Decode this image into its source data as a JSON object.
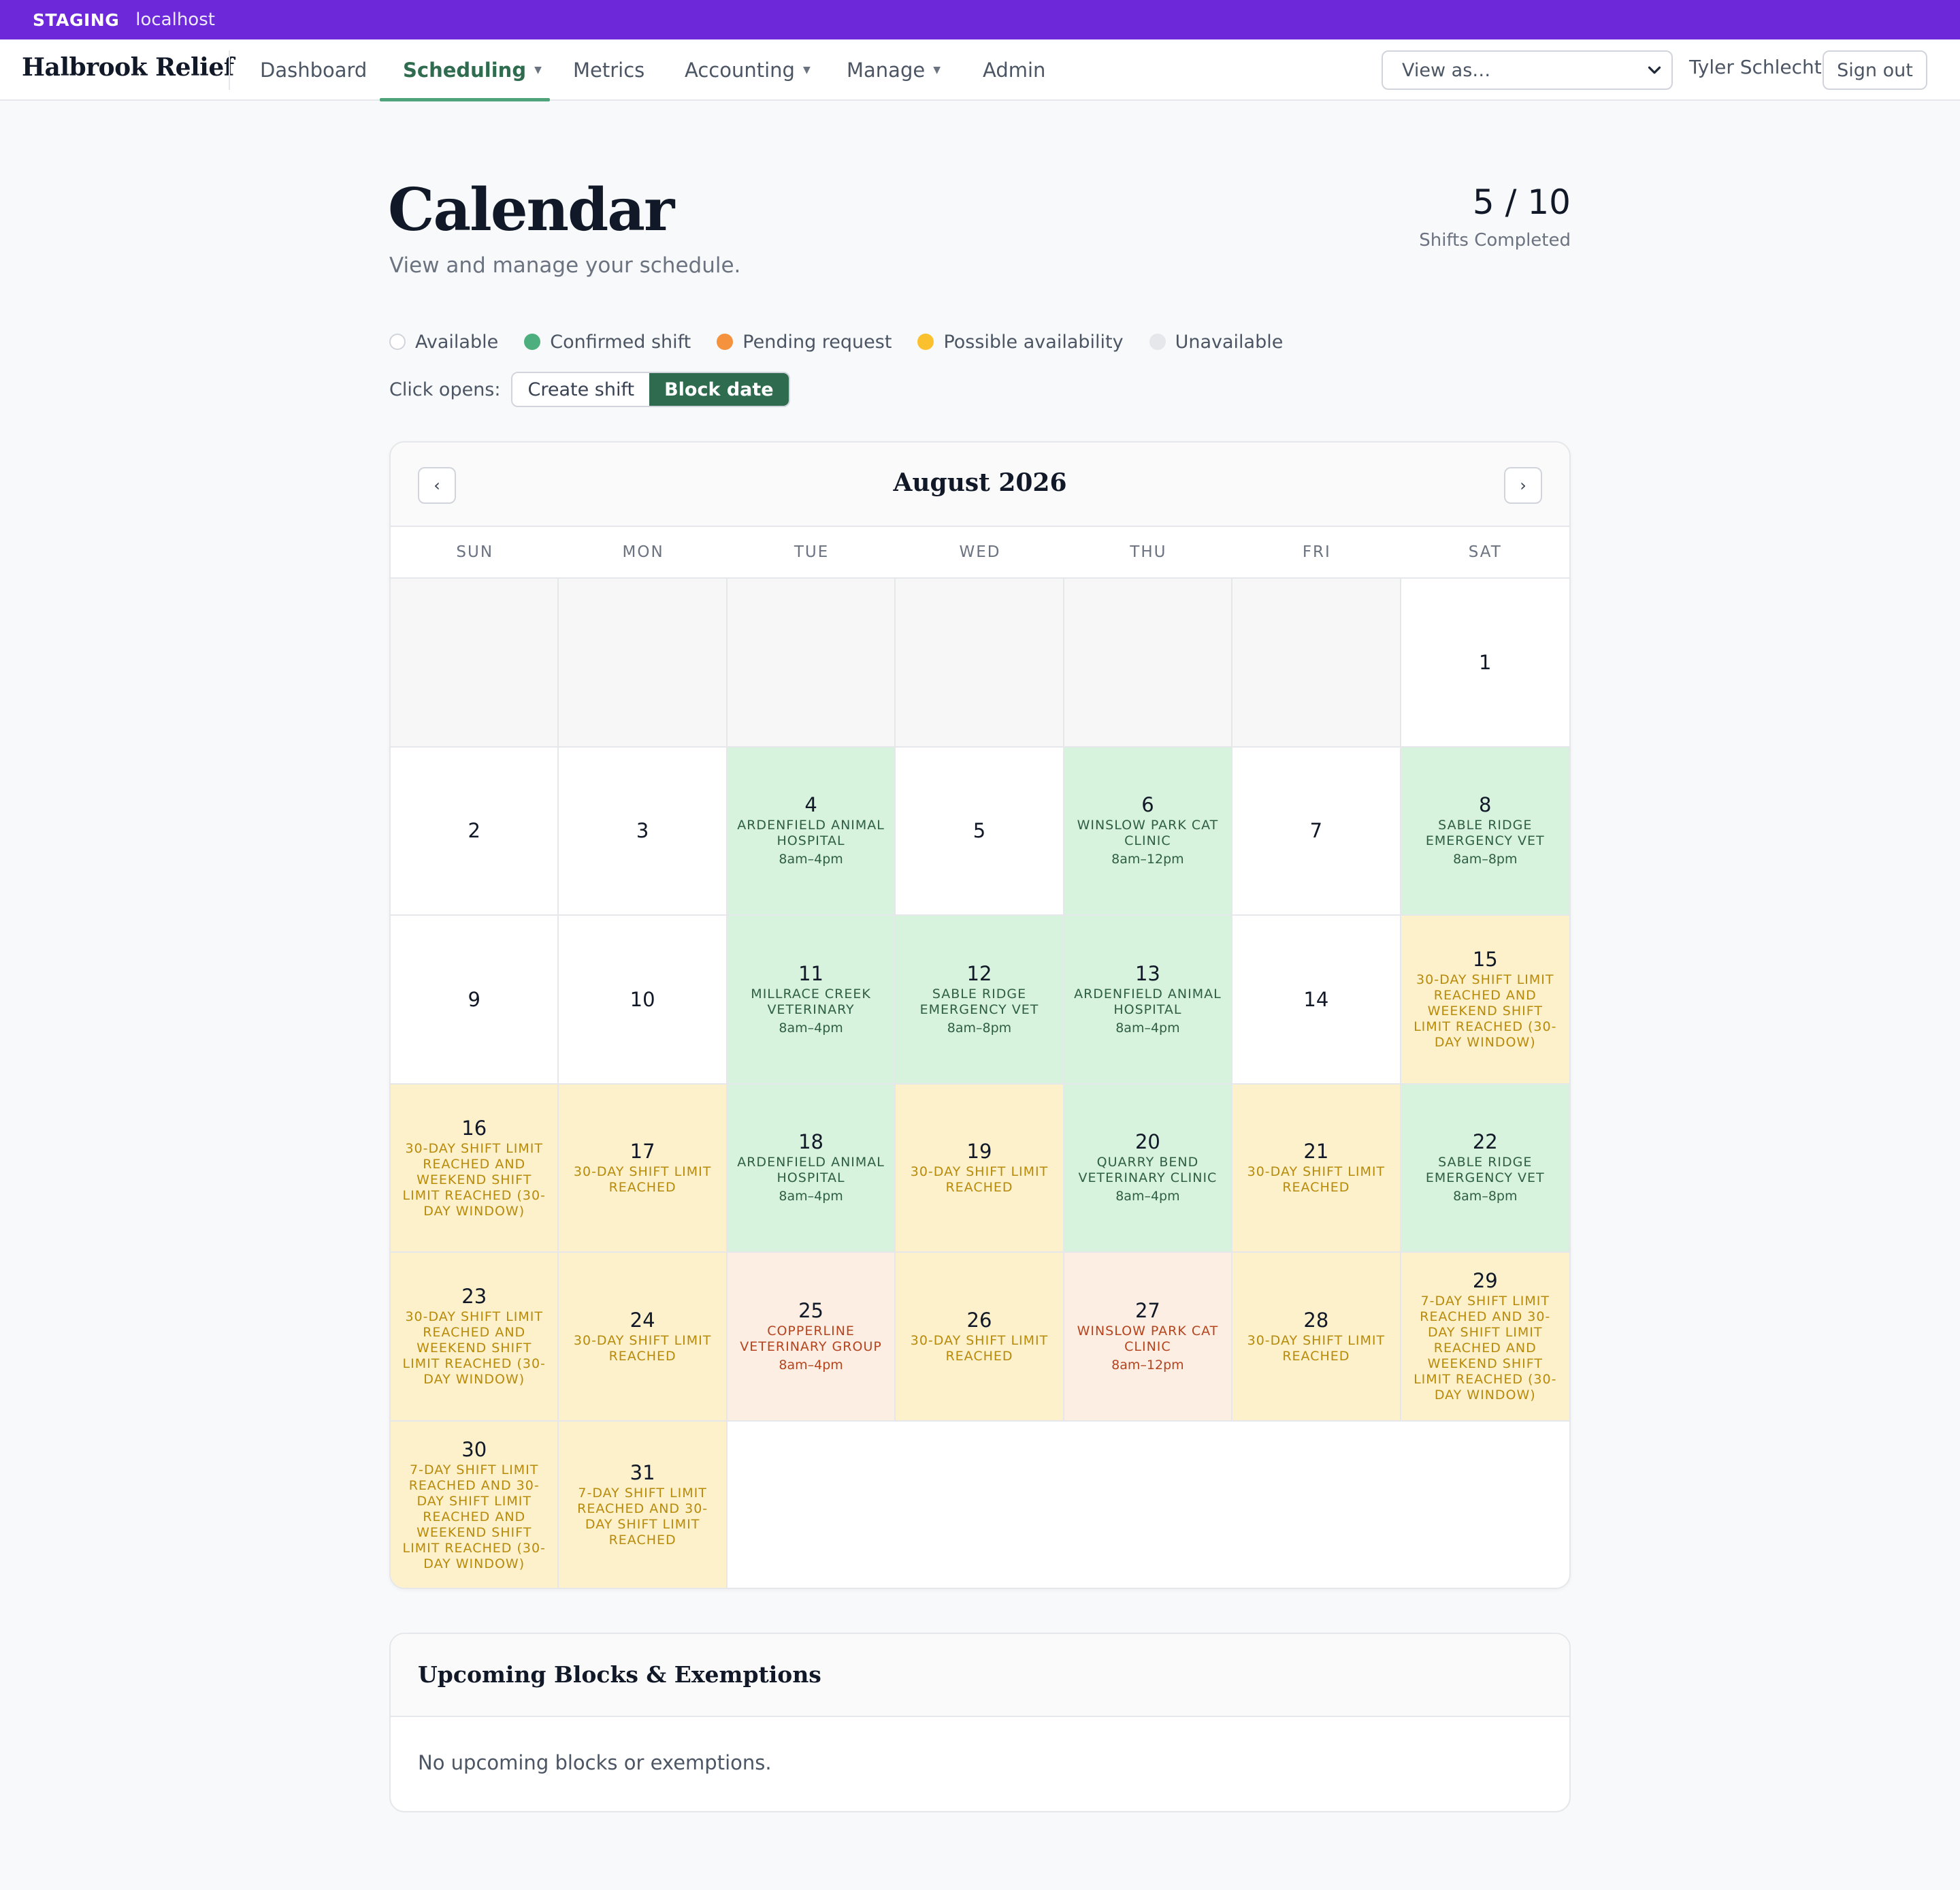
{
  "staging": {
    "tag": "STAGING",
    "host": "localhost"
  },
  "nav": {
    "brand": "Halbrook Relief",
    "items": [
      {
        "label": "Dashboard",
        "caret": false,
        "active": false
      },
      {
        "label": "Scheduling",
        "caret": true,
        "active": true
      },
      {
        "label": "Metrics",
        "caret": false,
        "active": false
      },
      {
        "label": "Accounting",
        "caret": true,
        "active": false
      },
      {
        "label": "Manage",
        "caret": true,
        "active": false
      },
      {
        "label": "Admin",
        "caret": false,
        "active": false
      }
    ],
    "view_as": "View as…",
    "user": "Tyler Schlecht",
    "sign_out": "Sign out"
  },
  "header": {
    "title": "Calendar",
    "subtitle": "View and manage your schedule.",
    "stat_value": "5 / 10",
    "stat_label": "Shifts Completed"
  },
  "legend": [
    {
      "label": "Available",
      "color": "#ffffff"
    },
    {
      "label": "Confirmed shift",
      "color": "#4caf7d"
    },
    {
      "label": "Pending request",
      "color": "#f5923e"
    },
    {
      "label": "Possible availability",
      "color": "#fbc02d"
    },
    {
      "label": "Unavailable",
      "color": "#e5e7eb"
    }
  ],
  "click_opens": {
    "label": "Click opens:",
    "options": [
      "Create shift",
      "Block date"
    ],
    "selected": "Block date"
  },
  "calendar": {
    "month": "August 2026",
    "prev": "‹",
    "next": "›",
    "weekdays": [
      "SUN",
      "MON",
      "TUE",
      "WED",
      "THU",
      "FRI",
      "SAT"
    ],
    "leading_blanks": 6,
    "days": [
      {
        "day": "1",
        "type": "available"
      },
      {
        "day": "2",
        "type": "available"
      },
      {
        "day": "3",
        "type": "available"
      },
      {
        "day": "4",
        "type": "confirmed",
        "clinic": "ARDENFIELD ANIMAL HOSPITAL",
        "time": "8am–4pm"
      },
      {
        "day": "5",
        "type": "available"
      },
      {
        "day": "6",
        "type": "confirmed",
        "clinic": "WINSLOW PARK CAT CLINIC",
        "time": "8am–12pm"
      },
      {
        "day": "7",
        "type": "available"
      },
      {
        "day": "8",
        "type": "confirmed",
        "clinic": "SABLE RIDGE EMERGENCY VET",
        "time": "8am–8pm"
      },
      {
        "day": "9",
        "type": "available"
      },
      {
        "day": "10",
        "type": "available"
      },
      {
        "day": "11",
        "type": "confirmed",
        "clinic": "MILLRACE CREEK VETERINARY",
        "time": "8am–4pm"
      },
      {
        "day": "12",
        "type": "confirmed",
        "clinic": "SABLE RIDGE EMERGENCY VET",
        "time": "8am–8pm"
      },
      {
        "day": "13",
        "type": "confirmed",
        "clinic": "ARDENFIELD ANIMAL HOSPITAL",
        "time": "8am–4pm"
      },
      {
        "day": "14",
        "type": "available"
      },
      {
        "day": "15",
        "type": "limit",
        "note": "30-DAY SHIFT LIMIT REACHED AND WEEKEND SHIFT LIMIT REACHED (30-DAY WINDOW)"
      },
      {
        "day": "16",
        "type": "limit",
        "note": "30-DAY SHIFT LIMIT REACHED AND WEEKEND SHIFT LIMIT REACHED (30-DAY WINDOW)"
      },
      {
        "day": "17",
        "type": "limit",
        "note": "30-DAY SHIFT LIMIT REACHED"
      },
      {
        "day": "18",
        "type": "confirmed",
        "clinic": "ARDENFIELD ANIMAL HOSPITAL",
        "time": "8am–4pm"
      },
      {
        "day": "19",
        "type": "limit",
        "note": "30-DAY SHIFT LIMIT REACHED"
      },
      {
        "day": "20",
        "type": "confirmed",
        "clinic": "QUARRY BEND VETERINARY CLINIC",
        "time": "8am–4pm"
      },
      {
        "day": "21",
        "type": "limit",
        "note": "30-DAY SHIFT LIMIT REACHED"
      },
      {
        "day": "22",
        "type": "confirmed",
        "clinic": "SABLE RIDGE EMERGENCY VET",
        "time": "8am–8pm"
      },
      {
        "day": "23",
        "type": "limit",
        "note": "30-DAY SHIFT LIMIT REACHED AND WEEKEND SHIFT LIMIT REACHED (30-DAY WINDOW)"
      },
      {
        "day": "24",
        "type": "limit",
        "note": "30-DAY SHIFT LIMIT REACHED"
      },
      {
        "day": "25",
        "type": "pending",
        "clinic": "COPPERLINE VETERINARY GROUP",
        "time": "8am–4pm"
      },
      {
        "day": "26",
        "type": "limit",
        "note": "30-DAY SHIFT LIMIT REACHED"
      },
      {
        "day": "27",
        "type": "pending",
        "clinic": "WINSLOW PARK CAT CLINIC",
        "time": "8am–12pm"
      },
      {
        "day": "28",
        "type": "limit",
        "note": "30-DAY SHIFT LIMIT REACHED"
      },
      {
        "day": "29",
        "type": "limit",
        "note": "7-DAY SHIFT LIMIT REACHED AND 30-DAY SHIFT LIMIT REACHED AND WEEKEND SHIFT LIMIT REACHED (30-DAY WINDOW)"
      },
      {
        "day": "30",
        "type": "limit",
        "note": "7-DAY SHIFT LIMIT REACHED AND 30-DAY SHIFT LIMIT REACHED AND WEEKEND SHIFT LIMIT REACHED (30-DAY WINDOW)"
      },
      {
        "day": "31",
        "type": "limit",
        "note": "7-DAY SHIFT LIMIT REACHED AND 30-DAY SHIFT LIMIT REACHED"
      }
    ]
  },
  "blocks": {
    "title": "Upcoming Blocks & Exemptions",
    "empty": "No upcoming blocks or exemptions."
  }
}
